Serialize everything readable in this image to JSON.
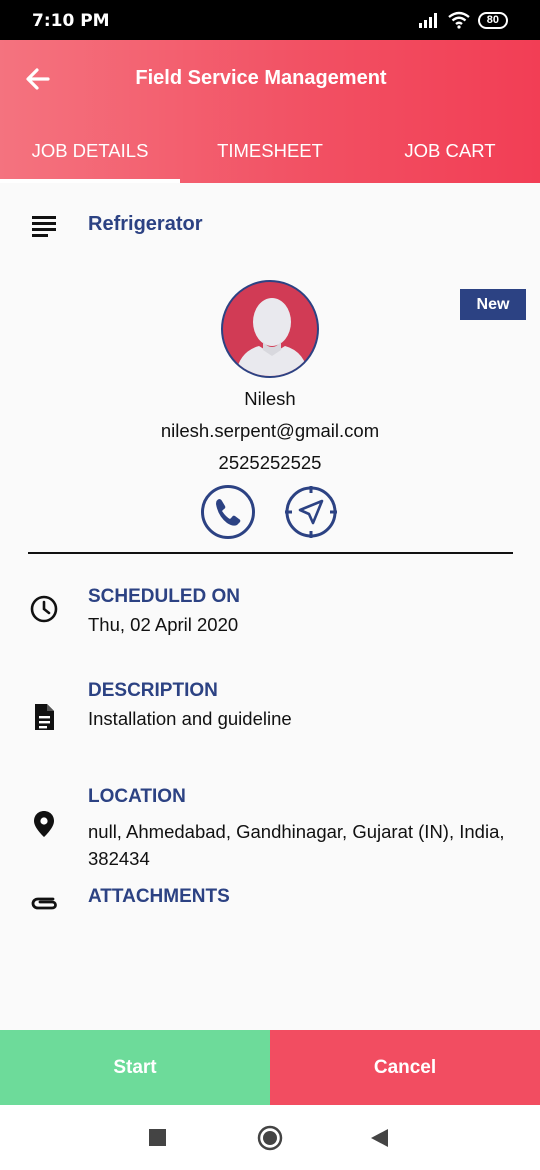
{
  "status_bar": {
    "time": "7:10 PM",
    "battery": "80"
  },
  "app_bar": {
    "title": "Field Service Management"
  },
  "tabs": [
    {
      "label": "JOB DETAILS",
      "active": true
    },
    {
      "label": "TIMESHEET",
      "active": false
    },
    {
      "label": "JOB CART",
      "active": false
    }
  ],
  "job": {
    "title": "Refrigerator",
    "status": "New"
  },
  "customer": {
    "name": "Nilesh",
    "email": "nilesh.serpent@gmail.com",
    "phone": "2525252525"
  },
  "details": {
    "scheduled": {
      "label": "SCHEDULED ON",
      "value": "Thu, 02 April 2020"
    },
    "description": {
      "label": "DESCRIPTION",
      "value": "Installation and guideline"
    },
    "location": {
      "label": "LOCATION",
      "value": "null, Ahmedabad, Gandhinagar, Gujarat (IN), India, 382434"
    },
    "attachments": {
      "label": "ATTACHMENTS"
    }
  },
  "actions": {
    "start": "Start",
    "cancel": "Cancel"
  },
  "colors": {
    "primary": "#2c4283",
    "accent": "#f24d61",
    "success": "#6ddb9a"
  }
}
